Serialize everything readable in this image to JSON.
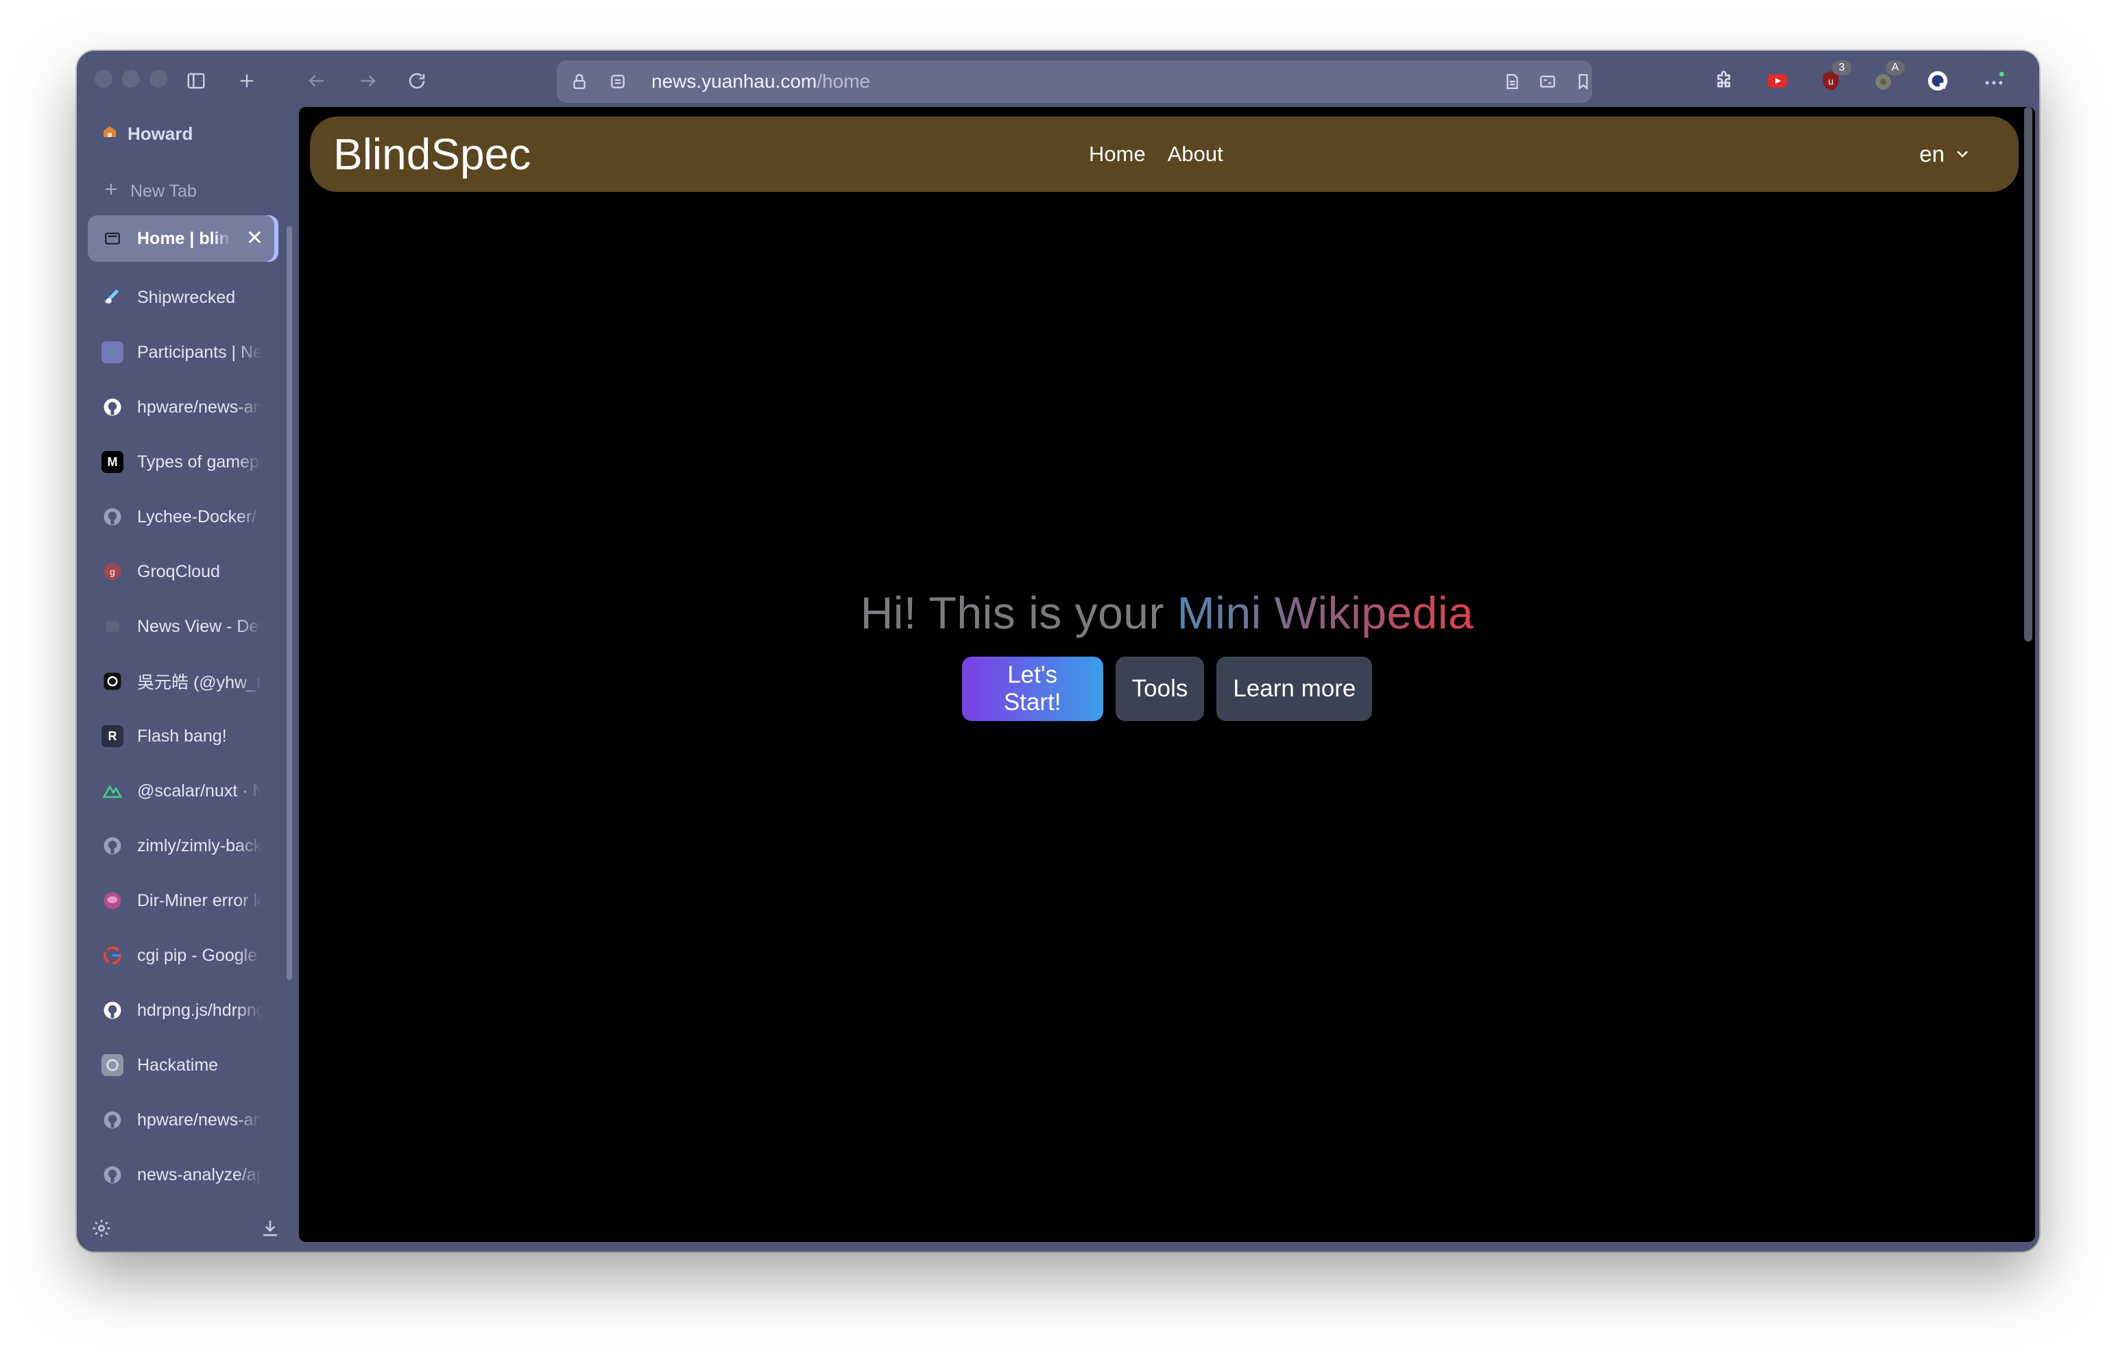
{
  "browser": {
    "url_host": "news.yuanhau.com",
    "url_path": "/home",
    "extension_badges": {
      "ublock": "3",
      "translate": "A"
    }
  },
  "sidebar": {
    "profile_name": "Howard",
    "new_tab_label": "New Tab",
    "tabs": [
      {
        "title": "Home | blindspec",
        "icon": "page-icon",
        "active": true
      },
      {
        "title": "Shipwrecked",
        "icon": "shipwrecked-icon"
      },
      {
        "title": "Participants | News",
        "icon": "page-icon"
      },
      {
        "title": "hpware/news-analyze",
        "icon": "github-icon"
      },
      {
        "title": "Types of gameplay",
        "icon": "medium-icon"
      },
      {
        "title": "Lychee-Docker/",
        "icon": "github-icon"
      },
      {
        "title": "GroqCloud",
        "icon": "groq-icon"
      },
      {
        "title": "News View - Dev",
        "icon": "page-icon"
      },
      {
        "title": "吳元皓 (@yhw_tw)",
        "icon": "threads-icon"
      },
      {
        "title": "Flash bang!",
        "icon": "r-icon"
      },
      {
        "title": "@scalar/nuxt · Nuxt",
        "icon": "nuxt-icon"
      },
      {
        "title": "zimly/zimly-backup",
        "icon": "github-icon"
      },
      {
        "title": "Dir-Miner error log",
        "icon": "chat-icon"
      },
      {
        "title": "cgi pip - Google Search",
        "icon": "google-icon"
      },
      {
        "title": "hdrpng.js/hdrpng",
        "icon": "github-icon"
      },
      {
        "title": "Hackatime",
        "icon": "hackatime-icon"
      },
      {
        "title": "hpware/news-analyze",
        "icon": "github-icon"
      },
      {
        "title": "news-analyze/app",
        "icon": "github-icon"
      }
    ]
  },
  "page": {
    "brand": "BlindSpec",
    "nav": {
      "home": "Home",
      "about": "About"
    },
    "language": "en",
    "hero": {
      "title_plain": "Hi! This is your ",
      "title_highlight": "Mini Wikipedia"
    },
    "buttons": {
      "start": "Let's Start!",
      "tools": "Tools",
      "learn_more": "Learn more"
    }
  },
  "colors": {
    "window_chrome": "#4f5677",
    "navbar_bg": "#5a4620",
    "primary_gradient_start": "#7b3fe4",
    "primary_gradient_end": "#3b9ee8",
    "secondary_button": "#3b4254"
  }
}
